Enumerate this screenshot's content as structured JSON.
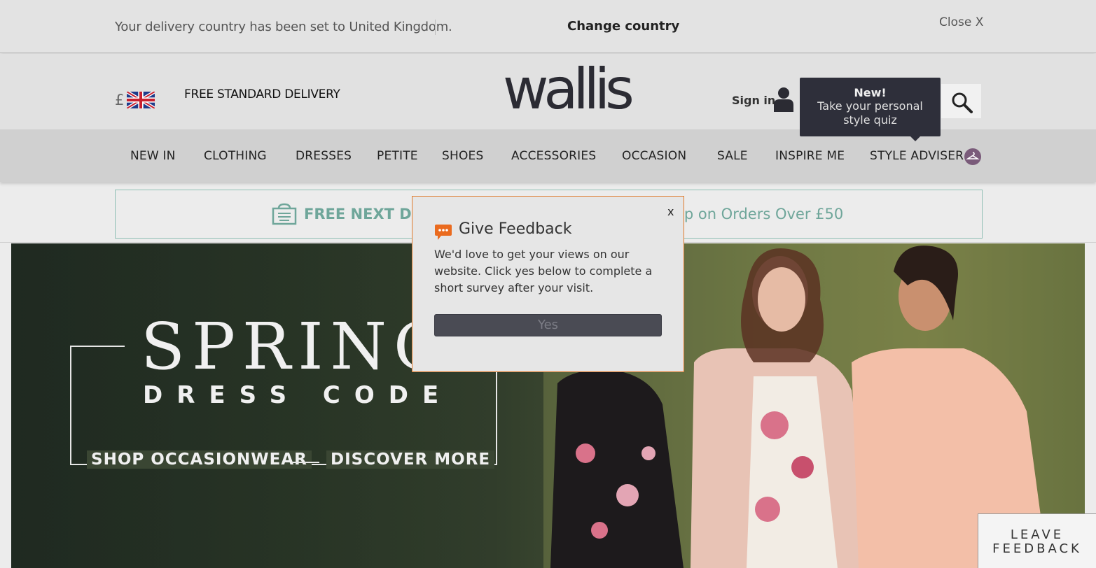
{
  "delivery_bar": {
    "message": "Your delivery country has been set to United Kingdom.",
    "change_country": "Change country",
    "close": "Close X"
  },
  "header": {
    "currency": "£",
    "flag_icon": "uk-flag-icon",
    "free_delivery": "FREE STANDARD DELIVERY",
    "logo": "wallis",
    "sign_in": "Sign in",
    "tooltip_title": "New!",
    "tooltip_body": "Take your personal style quiz"
  },
  "nav": {
    "items": [
      "NEW IN",
      "CLOTHING",
      "DRESSES",
      "PETITE",
      "SHOES",
      "ACCESSORIES",
      "OCCASION",
      "SALE",
      "INSPIRE ME",
      "STYLE ADVISER"
    ]
  },
  "promo": {
    "left": "FREE NEXT DAY",
    "right": "op on Orders Over £50"
  },
  "hero": {
    "title": "SPRING",
    "subtitle": "DRESS CODE",
    "cta_left": "SHOP OCCASIONWEAR",
    "cta_right": "DISCOVER MORE"
  },
  "feedback": {
    "close": "x",
    "title": "Give Feedback",
    "body": "We'd love to get your views on our website. Click yes below to complete a short survey after your visit.",
    "yes": "Yes"
  },
  "leave_feedback": {
    "line1": "LEAVE",
    "line2": "FEEDBACK"
  }
}
